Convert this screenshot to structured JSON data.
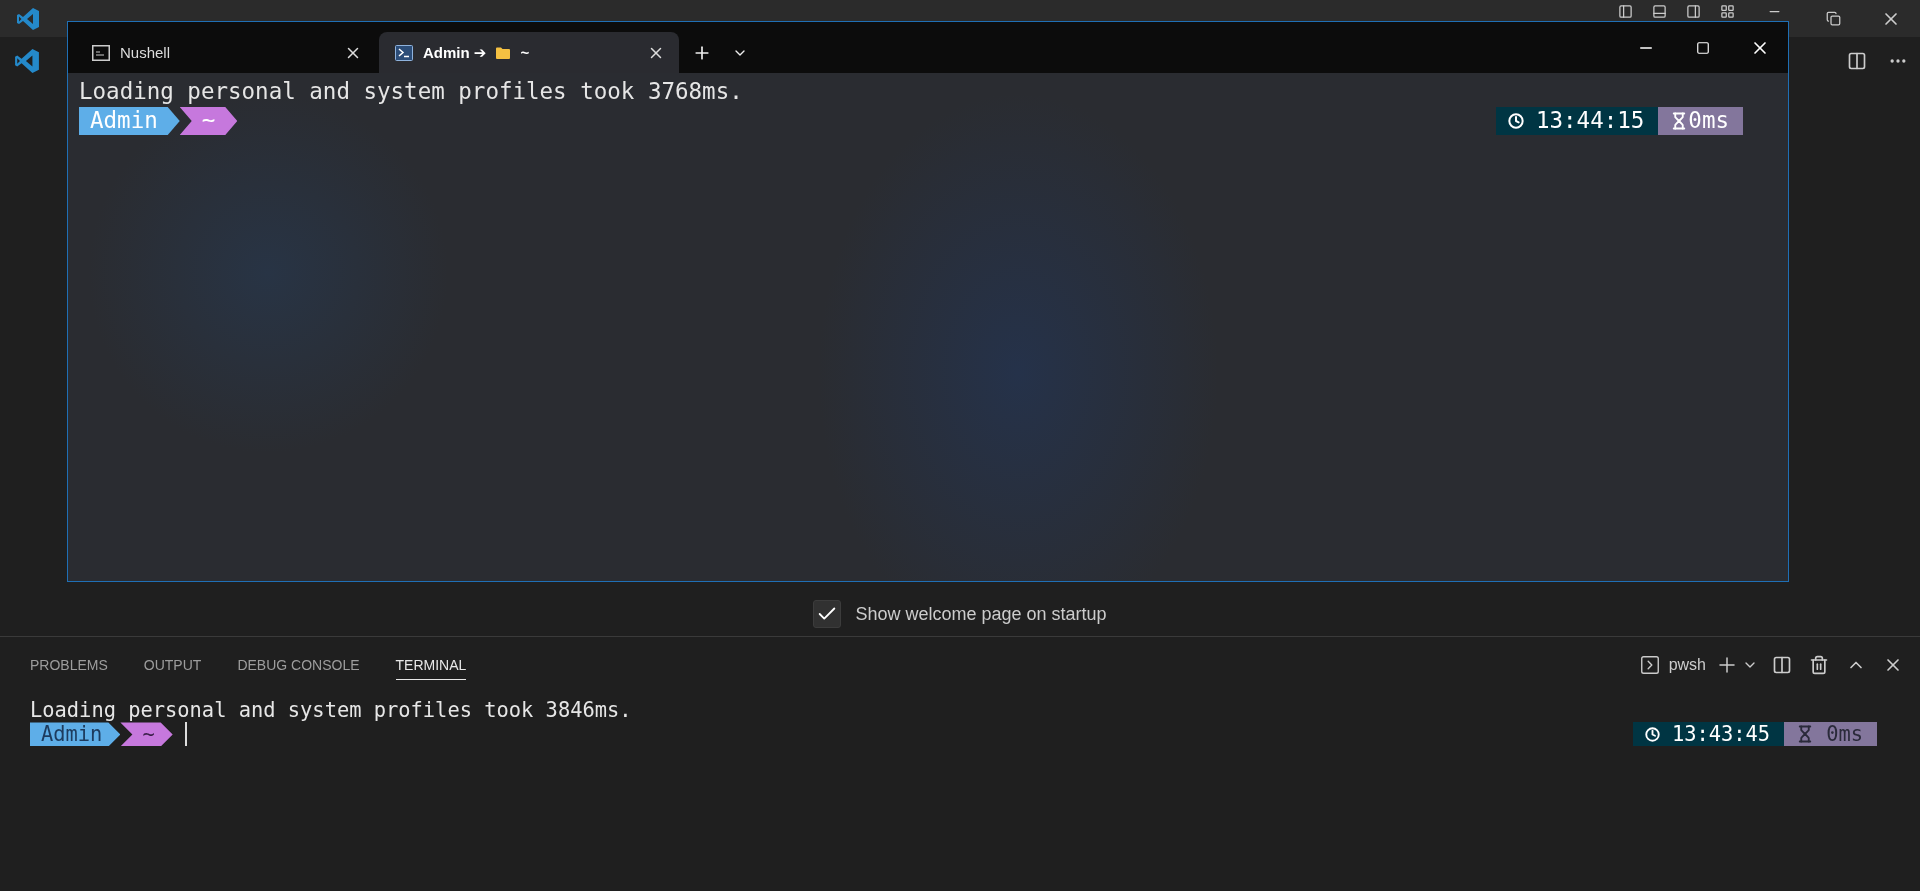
{
  "welcome": {
    "label": "Show welcome page on startup",
    "checked": true
  },
  "panel": {
    "tabs": [
      {
        "label": "PROBLEMS",
        "selected": false
      },
      {
        "label": "OUTPUT",
        "selected": false
      },
      {
        "label": "DEBUG CONSOLE",
        "selected": false
      },
      {
        "label": "TERMINAL",
        "selected": true
      }
    ],
    "profile": "pwsh",
    "terminal": {
      "lines": [
        "Loading personal and system profiles took 3846ms."
      ],
      "prompt": [
        "Admin",
        "~"
      ],
      "cursor": true,
      "time": "13:43:45",
      "duration": "0ms"
    }
  },
  "terminal_window": {
    "tabs": [
      {
        "kind": "cmd",
        "label": "Nushell",
        "selected": false
      },
      {
        "kind": "powershell",
        "label": "Admin ➔",
        "path": "~",
        "selected": true
      }
    ],
    "terminal": {
      "lines": [
        "Loading personal and system profiles took 3768ms."
      ],
      "prompt": [
        "Admin",
        "~"
      ],
      "time": "13:44:15",
      "duration": "0ms"
    }
  }
}
